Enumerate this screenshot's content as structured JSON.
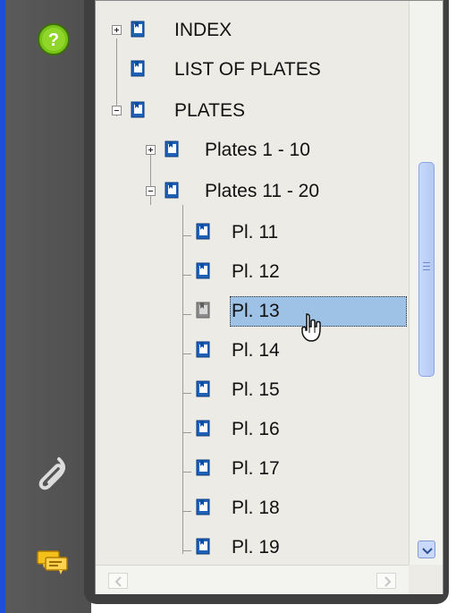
{
  "sidebar": {
    "icons": [
      "help-icon",
      "attachment-icon",
      "comments-icon"
    ]
  },
  "tree": {
    "items": [
      {
        "label": "INDEX",
        "level": 0,
        "expander": "plus",
        "icon": "bookmark-icon"
      },
      {
        "label": "LIST OF PLATES",
        "level": 0,
        "expander": "none",
        "icon": "bookmark-icon"
      },
      {
        "label": "PLATES",
        "level": 0,
        "expander": "minus",
        "icon": "bookmark-icon"
      },
      {
        "label": "Plates 1 - 10",
        "level": 1,
        "expander": "plus",
        "icon": "bookmark-icon"
      },
      {
        "label": "Plates 11 - 20",
        "level": 1,
        "expander": "minus",
        "icon": "bookmark-icon"
      },
      {
        "label": "Pl. 11",
        "level": 2,
        "icon": "bookmark-icon"
      },
      {
        "label": "Pl. 12",
        "level": 2,
        "icon": "bookmark-icon"
      },
      {
        "label": "Pl. 13",
        "level": 2,
        "icon": "bookmark-grey-icon",
        "selected": true
      },
      {
        "label": "Pl. 14",
        "level": 2,
        "icon": "bookmark-icon"
      },
      {
        "label": "Pl. 15",
        "level": 2,
        "icon": "bookmark-icon"
      },
      {
        "label": "Pl. 16",
        "level": 2,
        "icon": "bookmark-icon"
      },
      {
        "label": "Pl. 17",
        "level": 2,
        "icon": "bookmark-icon"
      },
      {
        "label": "Pl. 18",
        "level": 2,
        "icon": "bookmark-icon"
      },
      {
        "label": "Pl. 19",
        "level": 2,
        "icon": "bookmark-icon"
      }
    ]
  },
  "colors": {
    "selection": "#9ec2e6",
    "panel": "#ecebe6",
    "rail": "#545454",
    "scroll_thumb": "#bdd0f8"
  }
}
